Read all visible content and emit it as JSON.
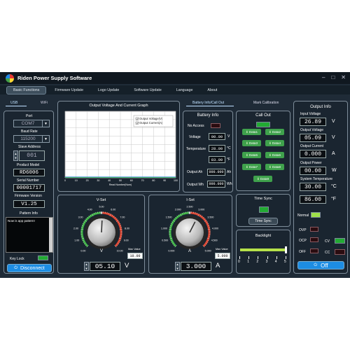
{
  "app": {
    "title": "Riden Power Supply Software",
    "min": "–",
    "max": "□",
    "close": "✕"
  },
  "menu": [
    "Basic Functions",
    "Firmware Update",
    "Logo Update",
    "Software Update",
    "Language",
    "About"
  ],
  "conn": {
    "tab_usb": "USB",
    "tab_wifi": "WiFi",
    "port_label": "Port",
    "port_value": "COM7",
    "baud_label": "Baud Rate",
    "baud_value": "115200",
    "slave_label": "Slave Address",
    "slave_value": "001",
    "model_label": "Product Model",
    "model_value": "RD6006",
    "serial_label": "Serial Number",
    "serial_value": "00001717",
    "fw_label": "Firmware Version",
    "fw_value": "V1.25",
    "pattern_label": "Pattern Info",
    "pattern_text": "Now is app pattern!",
    "keylock_label": "Key Lock",
    "disconnect_label": "Disconnect"
  },
  "graph": {
    "title": "Output Voltage And Current Graph",
    "legend": [
      "Output Voltage(V)",
      "Output Current(A)"
    ],
    "xlabel": "Read Number(Num)",
    "xticks": [
      "0",
      "10",
      "20",
      "30",
      "40",
      "50",
      "60",
      "70",
      "80",
      "90",
      "100"
    ],
    "series_colors": [
      "#2c7fd8",
      "#2bb34a"
    ]
  },
  "tabs2": {
    "battery_tab": "Battery Info/Call Out",
    "mark_tab": "Mark Calibration"
  },
  "battery": {
    "title": "Battery Info",
    "noaccess_label": "No Access",
    "voltage_label": "Voltage",
    "voltage_value": "00.00",
    "voltage_unit": "V",
    "temp_label": "Temperature",
    "temp_c_value": "28.00",
    "temp_c_unit": "°C",
    "temp_f_value": "83.00",
    "temp_f_unit": "°F",
    "ah_label": "Output Ah",
    "ah_value": "000.000",
    "ah_unit": "Ah",
    "wh_label": "Output Wh",
    "wh_value": "000.000",
    "wh_unit": "Wh"
  },
  "callout": {
    "title": "Call Out",
    "buttons": [
      "Data1",
      "Data2",
      "Data3",
      "Data4",
      "Data5",
      "Data6",
      "Data7",
      "Data8",
      "Data9"
    ]
  },
  "timesync": {
    "title": "Time Sync",
    "button": "Time Sync"
  },
  "backlight": {
    "title": "Backlight",
    "ticks": [
      "0",
      "1",
      "2",
      "3",
      "4",
      "5"
    ],
    "level_fraction": 1.0
  },
  "vset": {
    "title": "V-Set",
    "unit": "V",
    "value": "05.10",
    "max_label": "Max Value",
    "max_value": "10.00",
    "scale": [
      "0.00",
      "1.00",
      "2.00",
      "3.00",
      "4.00",
      "5.00",
      "6.00",
      "7.00",
      "8.00",
      "9.00",
      "10.00"
    ],
    "knob_fraction": 0.51
  },
  "iset": {
    "title": "I-Set",
    "unit": "A",
    "value": "3.000",
    "max_label": "Max Value",
    "max_value": "5.000",
    "scale": [
      "0.000",
      "0.500",
      "1.000",
      "1.500",
      "2.000",
      "2.500",
      "3.000",
      "3.500",
      "4.000",
      "4.500",
      "5.000"
    ],
    "knob_fraction": 0.6
  },
  "output": {
    "title": "Output Info",
    "vin_label": "Input Voltage",
    "vin_value": "26.89",
    "vin_unit": "V",
    "vout_label": "Output Voltage",
    "vout_value": "05.09",
    "vout_unit": "V",
    "iout_label": "Output Current",
    "iout_value": "0.000",
    "iout_unit": "A",
    "pout_label": "Output Power",
    "pout_value": "00.00",
    "pout_unit": "W",
    "tsys_label": "System Temperature",
    "tsys_value": "30.00",
    "tsys_unit": "°C",
    "tf_value": "86.00",
    "tf_unit": "°F",
    "normal_label": "Normal",
    "ovp_label": "OVP",
    "ocp_label": "OCP",
    "off_label": "OFF",
    "cv_label": "CV",
    "cc_label": "CC",
    "off_button": "Off"
  }
}
